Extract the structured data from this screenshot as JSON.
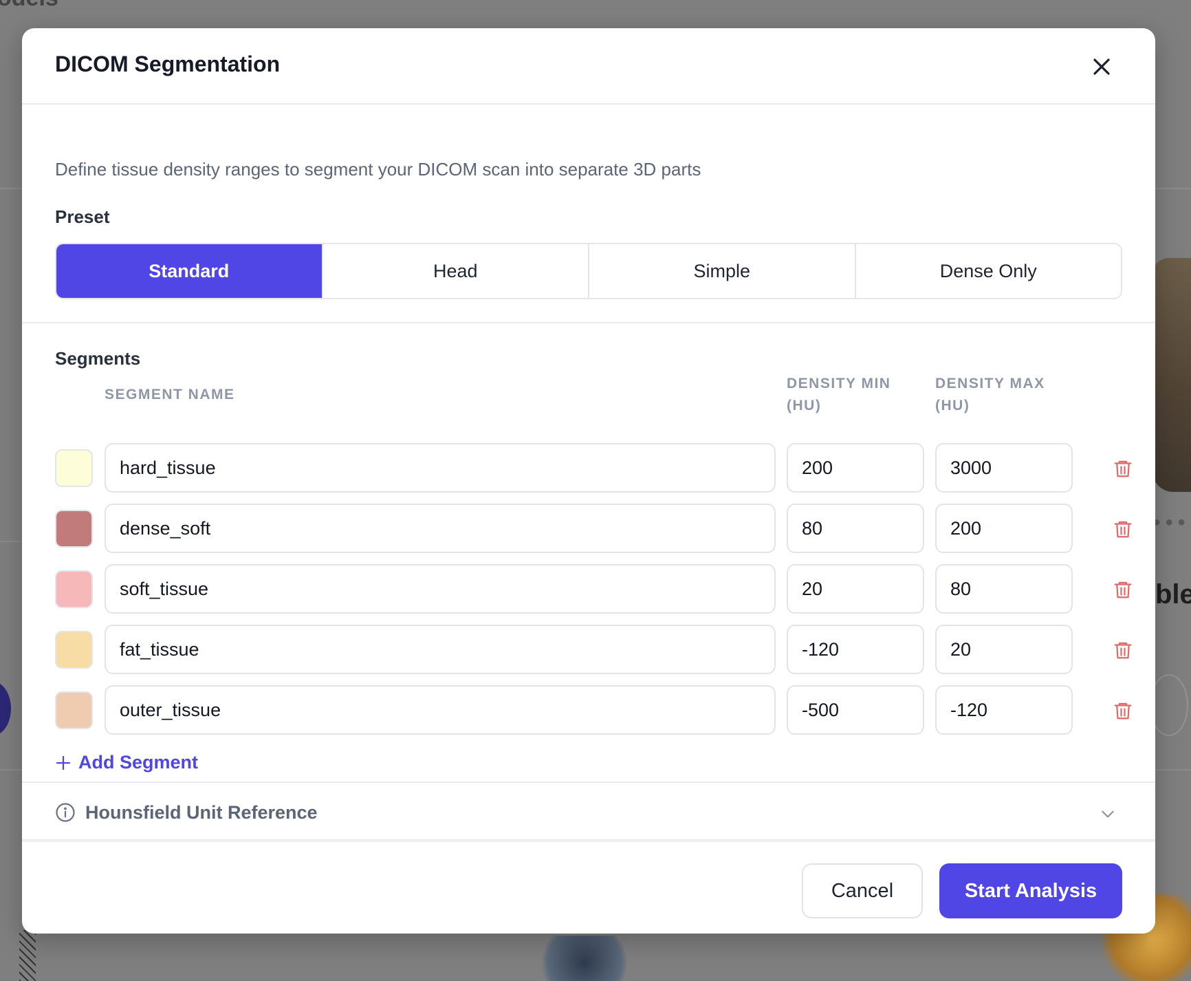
{
  "background": {
    "heading_fragment": "odels",
    "side_text_fragment": "ble"
  },
  "dialog": {
    "title": "DICOM Segmentation",
    "close_icon": "close-icon",
    "description": "Define tissue density ranges to segment your DICOM scan into separate 3D parts",
    "preset": {
      "label": "Preset",
      "options": [
        "Standard",
        "Head",
        "Simple",
        "Dense Only"
      ],
      "selected": "Standard"
    },
    "segments": {
      "title": "Segments",
      "columns": {
        "name": "SEGMENT NAME",
        "min_line1": "DENSITY MIN",
        "min_line2": "(HU)",
        "max_line1": "DENSITY MAX",
        "max_line2": "(HU)"
      },
      "rows": [
        {
          "name": "hard_tissue",
          "min": "200",
          "max": "3000",
          "color": "#fefdd9"
        },
        {
          "name": "dense_soft",
          "min": "80",
          "max": "200",
          "color": "#c27b7b"
        },
        {
          "name": "soft_tissue",
          "min": "20",
          "max": "80",
          "color": "#f6b8b8"
        },
        {
          "name": "fat_tissue",
          "min": "-120",
          "max": "20",
          "color": "#f8dca6"
        },
        {
          "name": "outer_tissue",
          "min": "-500",
          "max": "-120",
          "color": "#efccb0"
        }
      ],
      "add_label": "Add Segment"
    },
    "reference": {
      "label": "Hounsfield Unit Reference"
    },
    "footer": {
      "cancel": "Cancel",
      "start": "Start Analysis"
    },
    "colors": {
      "accent": "#4f46e5",
      "delete": "#e06a6a"
    }
  }
}
